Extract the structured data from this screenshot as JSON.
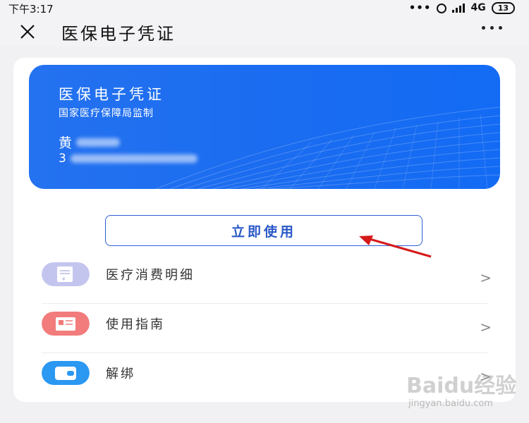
{
  "status_bar": {
    "time": "下午3:17",
    "dots": "•••",
    "network": "4G",
    "network_sub": "ill",
    "battery": "13"
  },
  "header": {
    "title": "医保电子凭证"
  },
  "card": {
    "title": "医保电子凭证",
    "subtitle": "国家医疗保障局监制",
    "name_visible": "黄",
    "id_visible": "3"
  },
  "use_button": {
    "label": "立即使用"
  },
  "menu": {
    "items": [
      {
        "label": "医疗消费明细",
        "icon": "receipt-icon",
        "icon_color": "#c4c5ef",
        "chevron": ">"
      },
      {
        "label": "使用指南",
        "icon": "guide-icon",
        "icon_color": "#f27b7b",
        "chevron": ">"
      },
      {
        "label": "解绑",
        "icon": "wallet-icon",
        "icon_color": "#2b98f2",
        "chevron": ">"
      }
    ]
  },
  "watermark": {
    "brand": "Baidu经验",
    "url": "jingyan.baidu.com"
  },
  "colors": {
    "card_blue": "#1b6cf0",
    "button_border": "#2d5fd6",
    "arrow_red": "#d61a1a"
  }
}
